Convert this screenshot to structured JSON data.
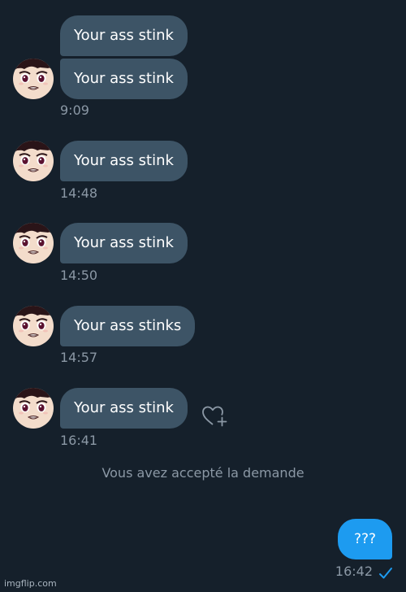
{
  "messages": [
    {
      "text": "Your ass stink"
    },
    {
      "text": "Your ass stink"
    },
    {
      "text": "Your ass stink"
    },
    {
      "text": "Your ass stink"
    },
    {
      "text": "Your ass stinks"
    },
    {
      "text": "Your ass stink"
    }
  ],
  "times": [
    "9:09",
    "14:48",
    "14:50",
    "14:57",
    "16:41"
  ],
  "system_notice": "Vous avez accepté la demande",
  "outgoing": {
    "text": "???",
    "time": "16:42",
    "status_icon": "check-icon"
  },
  "reaction_icon": "heart-plus-icon",
  "watermark": "imgflip.com",
  "colors": {
    "background": "#15202b",
    "incoming_bubble": "#3d5466",
    "outgoing_bubble": "#1d9bf0",
    "muted_text": "#8b98a5"
  }
}
